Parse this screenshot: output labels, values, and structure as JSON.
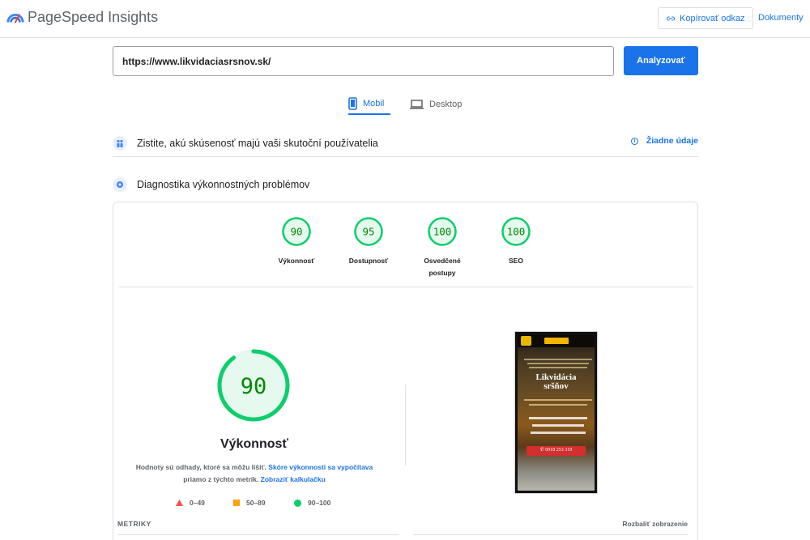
{
  "header": {
    "brand": "PageSpeed Insights",
    "copy_link": "Kopírovať odkaz",
    "docs": "Dokumenty"
  },
  "search": {
    "url": "https://www.likvidaciasrsnov.sk/",
    "analyze": "Analyzovať"
  },
  "tabs": [
    {
      "label": "Mobil",
      "icon": "smartphone-icon",
      "active": true
    },
    {
      "label": "Desktop",
      "icon": "laptop-icon",
      "active": false
    }
  ],
  "field_data": {
    "title": "Zistite, akú skúsenosť majú vaši skutoční používatelia",
    "status": "Žiadne údaje"
  },
  "diagnostics": {
    "title": "Diagnostika výkonnostných problémov"
  },
  "scores": [
    {
      "value": 90,
      "label": "Výkonnosť"
    },
    {
      "value": 95,
      "label": "Dostupnosť"
    },
    {
      "value": 100,
      "label": "Osvedčené postupy"
    },
    {
      "value": 100,
      "label": "SEO"
    }
  ],
  "performance": {
    "score": 90,
    "title": "Výkonnosť",
    "note_prefix": "Hodnoty sú odhady, ktoré sa môžu líšiť.",
    "note_link1": "Skóre výkonnosti sa vypočítava",
    "note_middle": "priamo z týchto metrík.",
    "note_link2": "Zobraziť kalkulačku",
    "legend": [
      "0–49",
      "50–89",
      "90–100"
    ]
  },
  "preview": {
    "heading_line1": "Likvidácia",
    "heading_line2": "sršňov",
    "phone": "✆ 0918 253 319"
  },
  "metrics": {
    "label": "METRIKY",
    "expand": "Rozbaliť zobrazenie"
  },
  "colors": {
    "accent": "#1a73e8",
    "pass": "#0cce6b",
    "pass_text": "#008800",
    "pass_bg": "#e6f9ee",
    "average": "#ffa400",
    "fail": "#ff4e42"
  }
}
